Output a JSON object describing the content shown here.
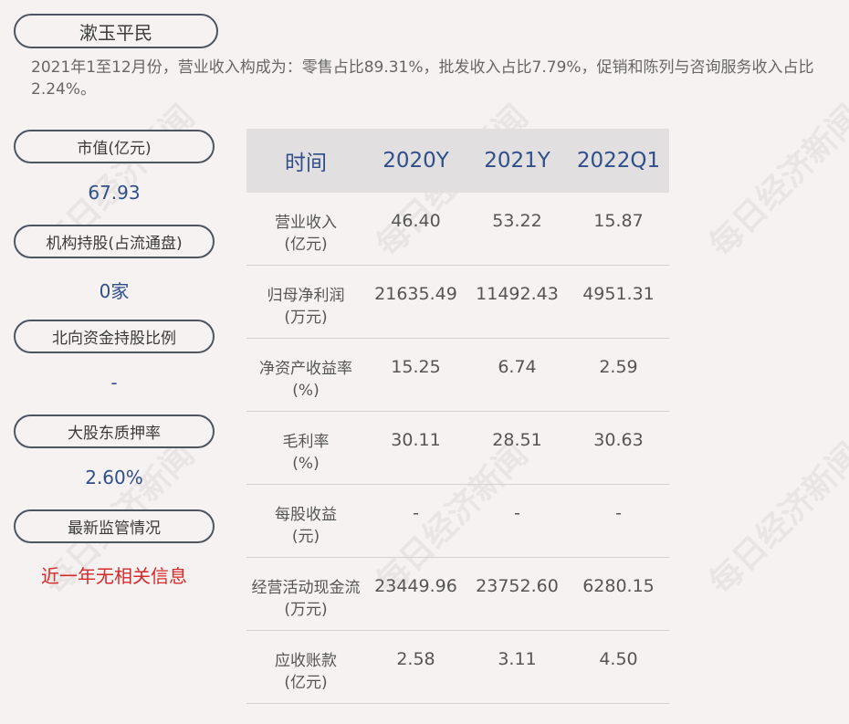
{
  "company": "漱玉平民",
  "intro": "2021年1至12月份，营业收入构成为：零售占比89.31%，批发收入占比7.79%，促销和陈列与咨询服务收入占比2.24%。",
  "metrics": [
    {
      "label": "市值(亿元)",
      "value": "67.93"
    },
    {
      "label": "机构持股(占流通盘)",
      "value": "0家"
    },
    {
      "label": "北向资金持股比例",
      "value": "-"
    },
    {
      "label": "大股东质押率",
      "value": "2.60%"
    },
    {
      "label": "最新监管情况",
      "value": "近一年无相关信息"
    }
  ],
  "table": {
    "header": [
      "时间",
      "2020Y",
      "2021Y",
      "2022Q1"
    ],
    "rows": [
      {
        "name": "营业收入",
        "unit": "(亿元)",
        "values": [
          "46.40",
          "53.22",
          "15.87"
        ]
      },
      {
        "name": "归母净利润",
        "unit": "(万元)",
        "values": [
          "21635.49",
          "11492.43",
          "4951.31"
        ]
      },
      {
        "name": "净资产收益率",
        "unit": "(%)",
        "values": [
          "15.25",
          "6.74",
          "2.59"
        ]
      },
      {
        "name": "毛利率",
        "unit": "(%)",
        "values": [
          "30.11",
          "28.51",
          "30.63"
        ]
      },
      {
        "name": "每股收益",
        "unit": "(元)",
        "values": [
          "-",
          "-",
          "-"
        ]
      },
      {
        "name": "经营活动现金流",
        "unit": "(万元)",
        "values": [
          "23449.96",
          "23752.60",
          "6280.15"
        ]
      },
      {
        "name": "应收账款",
        "unit": "(亿元)",
        "values": [
          "2.58",
          "3.11",
          "4.50"
        ]
      }
    ]
  },
  "watermark": "每日经济新闻"
}
